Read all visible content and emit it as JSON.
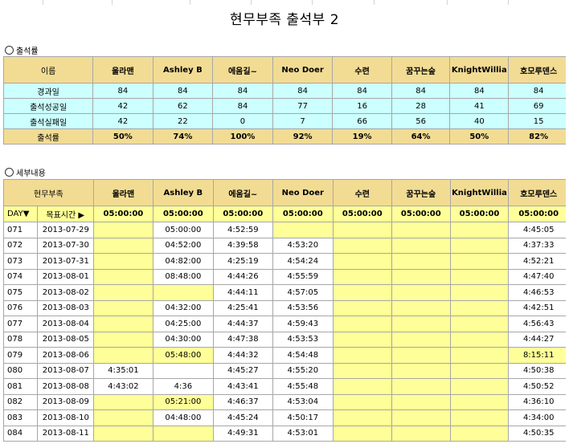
{
  "title": "현무부족 출석부 2",
  "section1": "출석률",
  "section2": "세부내용",
  "players": [
    "울라맨",
    "Ashley B",
    "에움길~",
    "Neo Doer",
    "수련",
    "꿈꾸는숲",
    "KnightWillia",
    "호모루덴스"
  ],
  "summary": {
    "header_label": "이름",
    "rows": [
      {
        "label": "경과일",
        "values": [
          "84",
          "84",
          "84",
          "84",
          "84",
          "84",
          "84",
          "84"
        ]
      },
      {
        "label": "출석성공일",
        "values": [
          "42",
          "62",
          "84",
          "77",
          "16",
          "28",
          "41",
          "69"
        ]
      },
      {
        "label": "출석실패일",
        "values": [
          "42",
          "22",
          "0",
          "7",
          "66",
          "56",
          "40",
          "15"
        ]
      }
    ],
    "rate": {
      "label": "출석률",
      "values": [
        "50%",
        "74%",
        "100%",
        "92%",
        "19%",
        "64%",
        "50%",
        "82%"
      ]
    }
  },
  "detail": {
    "header_label": "현무부족",
    "day_label": "DAY▼",
    "target_label": "목표시간 ▶",
    "targets": [
      "05:00:00",
      "05:00:00",
      "05:00:00",
      "05:00:00",
      "05:00:00",
      "05:00:00",
      "05:00:00",
      "05:00:00"
    ],
    "rows": [
      {
        "day": "071",
        "date": "2013-07-29",
        "v": [
          "",
          "05:00:00",
          "4:52:59",
          "",
          "",
          "",
          "",
          "4:45:05"
        ],
        "y": [
          1,
          0,
          0,
          1,
          1,
          1,
          1,
          0
        ]
      },
      {
        "day": "072",
        "date": "2013-07-30",
        "v": [
          "",
          "04:52:00",
          "4:39:58",
          "4:53:20",
          "",
          "",
          "",
          "4:37:33"
        ],
        "y": [
          1,
          0,
          0,
          0,
          1,
          1,
          1,
          0
        ]
      },
      {
        "day": "073",
        "date": "2013-07-31",
        "v": [
          "",
          "04:82:00",
          "4:25:19",
          "4:54:24",
          "",
          "",
          "",
          "4:52:21"
        ],
        "y": [
          1,
          0,
          0,
          0,
          1,
          1,
          1,
          0
        ]
      },
      {
        "day": "074",
        "date": "2013-08-01",
        "v": [
          "",
          "08:48:00",
          "4:44:26",
          "4:55:59",
          "",
          "",
          "",
          "4:47:40"
        ],
        "y": [
          1,
          0,
          0,
          0,
          1,
          1,
          1,
          0
        ]
      },
      {
        "day": "075",
        "date": "2013-08-02",
        "v": [
          "",
          "",
          "4:44:11",
          "4:57:05",
          "",
          "",
          "",
          "4:46:53"
        ],
        "y": [
          1,
          1,
          0,
          0,
          1,
          1,
          1,
          0
        ]
      },
      {
        "day": "076",
        "date": "2013-08-03",
        "v": [
          "",
          "04:32:00",
          "4:25:41",
          "4:53:56",
          "",
          "",
          "",
          "4:42:51"
        ],
        "y": [
          1,
          0,
          0,
          0,
          1,
          1,
          1,
          0
        ]
      },
      {
        "day": "077",
        "date": "2013-08-04",
        "v": [
          "",
          "04:25:00",
          "4:44:37",
          "4:59:43",
          "",
          "",
          "",
          "4:56:43"
        ],
        "y": [
          1,
          0,
          0,
          0,
          1,
          1,
          1,
          0
        ]
      },
      {
        "day": "078",
        "date": "2013-08-05",
        "v": [
          "",
          "04:30:00",
          "4:47:38",
          "4:53:53",
          "",
          "",
          "",
          "4:44:27"
        ],
        "y": [
          1,
          0,
          0,
          0,
          1,
          1,
          1,
          0
        ]
      },
      {
        "day": "079",
        "date": "2013-08-06",
        "v": [
          "",
          "05:48:00",
          "4:44:32",
          "4:54:48",
          "",
          "",
          "",
          "8:15:11"
        ],
        "y": [
          1,
          1,
          0,
          0,
          1,
          1,
          1,
          1
        ]
      },
      {
        "day": "080",
        "date": "2013-08-07",
        "v": [
          "4:35:01",
          "",
          "4:45:27",
          "4:55:20",
          "",
          "",
          "",
          "4:50:38"
        ],
        "y": [
          0,
          0,
          0,
          0,
          1,
          1,
          1,
          0
        ]
      },
      {
        "day": "081",
        "date": "2013-08-08",
        "v": [
          "4:43:02",
          "4:36",
          "4:43:41",
          "4:55:48",
          "",
          "",
          "",
          "4:50:52"
        ],
        "y": [
          0,
          0,
          0,
          0,
          1,
          1,
          1,
          0
        ]
      },
      {
        "day": "082",
        "date": "2013-08-09",
        "v": [
          "",
          "05:21:00",
          "4:46:37",
          "4:53:04",
          "",
          "",
          "",
          "4:36:10"
        ],
        "y": [
          1,
          1,
          0,
          0,
          1,
          1,
          1,
          0
        ]
      },
      {
        "day": "083",
        "date": "2013-08-10",
        "v": [
          "",
          "04:48:00",
          "4:45:24",
          "4:50:17",
          "",
          "",
          "",
          "4:34:00"
        ],
        "y": [
          1,
          0,
          0,
          0,
          1,
          1,
          1,
          0
        ]
      },
      {
        "day": "084",
        "date": "2013-08-11",
        "v": [
          "",
          "",
          "4:49:31",
          "4:53:01",
          "",
          "",
          "",
          "4:50:35"
        ],
        "y": [
          1,
          1,
          0,
          0,
          1,
          1,
          1,
          0
        ]
      }
    ]
  }
}
